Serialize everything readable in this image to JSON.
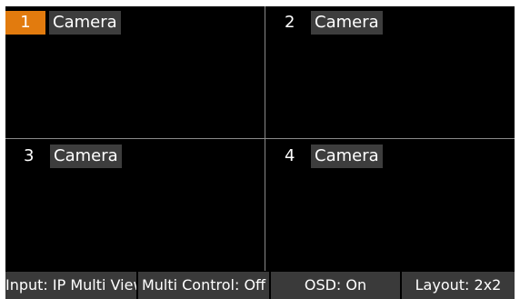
{
  "cameras": [
    {
      "number": "1",
      "name": "Camera",
      "selected": true
    },
    {
      "number": "2",
      "name": "Camera",
      "selected": false
    },
    {
      "number": "3",
      "name": "Camera",
      "selected": false
    },
    {
      "number": "4",
      "name": "Camera",
      "selected": false
    }
  ],
  "status_bar": {
    "input": "Input: IP Multi View",
    "multi_control": "Multi Control: Off",
    "osd": "OSD: On",
    "layout": "Layout: 2x2"
  },
  "colors": {
    "selected_accent": "#e27b0e",
    "label_background": "#3d3d3d",
    "status_background": "#3a3a3a",
    "divider": "#8a8a8a"
  }
}
